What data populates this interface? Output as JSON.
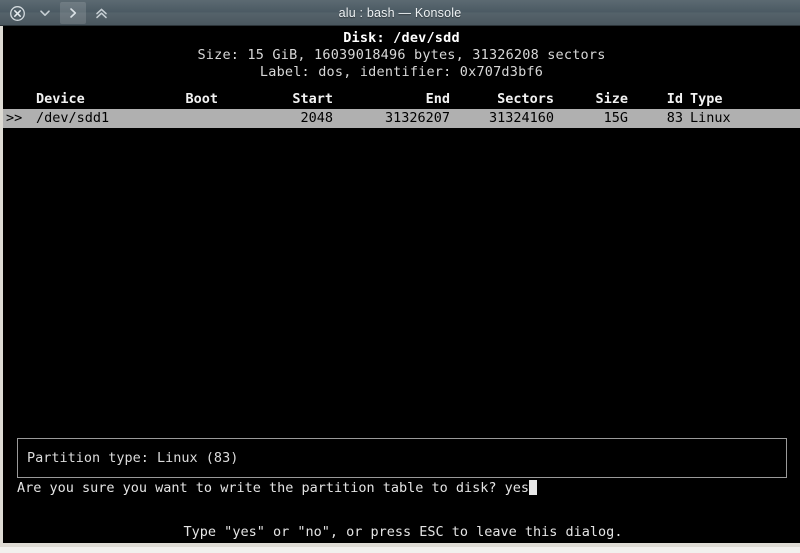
{
  "titlebar": {
    "title": "alu : bash — Konsole",
    "buttons": [
      {
        "name": "close-icon",
        "glyph": "x"
      },
      {
        "name": "chevron-down-icon",
        "glyph": "v"
      },
      {
        "name": "chevron-right-icon",
        "glyph": ">"
      },
      {
        "name": "chevron-double-up-icon",
        "glyph": "^^"
      }
    ]
  },
  "disk": {
    "line1": "Disk: /dev/sdd",
    "line2": "Size: 15 GiB, 16039018496 bytes, 31326208 sectors",
    "line3": "Label: dos, identifier: 0x707d3bf6"
  },
  "table": {
    "columns": [
      "Device",
      "Boot",
      "Start",
      "End",
      "Sectors",
      "Size",
      "Id",
      "Type"
    ],
    "rows": [
      {
        "marker": ">>",
        "device": "/dev/sdd1",
        "boot": "",
        "start": "2048",
        "end": "31326207",
        "sectors": "31324160",
        "size": "15G",
        "id": "83",
        "type": "Linux",
        "selected": true
      }
    ]
  },
  "dialog": {
    "info": "Partition type: Linux (83)",
    "prompt": "Are you sure you want to write the partition table to disk? ",
    "answer": "yes",
    "hint": "Type \"yes\" or \"no\", or press ESC to leave this dialog."
  },
  "colors": {
    "titlebar": "#4f5d66",
    "terminal_bg": "#000000",
    "terminal_fg": "#d8d8d8",
    "selection_bg": "#b0b0b0",
    "selection_fg": "#000000",
    "window_frame": "#dedbd4"
  }
}
